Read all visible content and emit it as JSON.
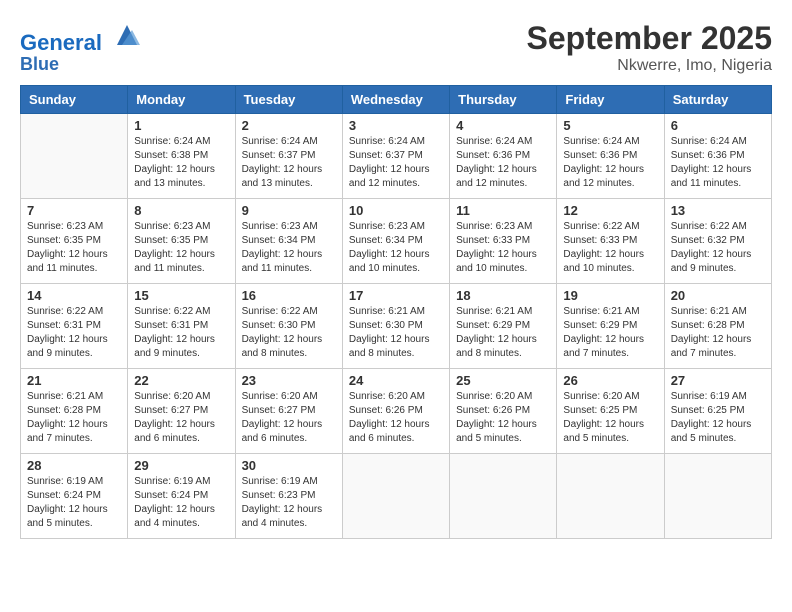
{
  "header": {
    "logo_line1": "General",
    "logo_line2": "Blue",
    "month_title": "September 2025",
    "location": "Nkwerre, Imo, Nigeria"
  },
  "days_of_week": [
    "Sunday",
    "Monday",
    "Tuesday",
    "Wednesday",
    "Thursday",
    "Friday",
    "Saturday"
  ],
  "weeks": [
    [
      {
        "day": "",
        "info": ""
      },
      {
        "day": "1",
        "info": "Sunrise: 6:24 AM\nSunset: 6:38 PM\nDaylight: 12 hours\nand 13 minutes."
      },
      {
        "day": "2",
        "info": "Sunrise: 6:24 AM\nSunset: 6:37 PM\nDaylight: 12 hours\nand 13 minutes."
      },
      {
        "day": "3",
        "info": "Sunrise: 6:24 AM\nSunset: 6:37 PM\nDaylight: 12 hours\nand 12 minutes."
      },
      {
        "day": "4",
        "info": "Sunrise: 6:24 AM\nSunset: 6:36 PM\nDaylight: 12 hours\nand 12 minutes."
      },
      {
        "day": "5",
        "info": "Sunrise: 6:24 AM\nSunset: 6:36 PM\nDaylight: 12 hours\nand 12 minutes."
      },
      {
        "day": "6",
        "info": "Sunrise: 6:24 AM\nSunset: 6:36 PM\nDaylight: 12 hours\nand 11 minutes."
      }
    ],
    [
      {
        "day": "7",
        "info": "Sunrise: 6:23 AM\nSunset: 6:35 PM\nDaylight: 12 hours\nand 11 minutes."
      },
      {
        "day": "8",
        "info": "Sunrise: 6:23 AM\nSunset: 6:35 PM\nDaylight: 12 hours\nand 11 minutes."
      },
      {
        "day": "9",
        "info": "Sunrise: 6:23 AM\nSunset: 6:34 PM\nDaylight: 12 hours\nand 11 minutes."
      },
      {
        "day": "10",
        "info": "Sunrise: 6:23 AM\nSunset: 6:34 PM\nDaylight: 12 hours\nand 10 minutes."
      },
      {
        "day": "11",
        "info": "Sunrise: 6:23 AM\nSunset: 6:33 PM\nDaylight: 12 hours\nand 10 minutes."
      },
      {
        "day": "12",
        "info": "Sunrise: 6:22 AM\nSunset: 6:33 PM\nDaylight: 12 hours\nand 10 minutes."
      },
      {
        "day": "13",
        "info": "Sunrise: 6:22 AM\nSunset: 6:32 PM\nDaylight: 12 hours\nand 9 minutes."
      }
    ],
    [
      {
        "day": "14",
        "info": "Sunrise: 6:22 AM\nSunset: 6:31 PM\nDaylight: 12 hours\nand 9 minutes."
      },
      {
        "day": "15",
        "info": "Sunrise: 6:22 AM\nSunset: 6:31 PM\nDaylight: 12 hours\nand 9 minutes."
      },
      {
        "day": "16",
        "info": "Sunrise: 6:22 AM\nSunset: 6:30 PM\nDaylight: 12 hours\nand 8 minutes."
      },
      {
        "day": "17",
        "info": "Sunrise: 6:21 AM\nSunset: 6:30 PM\nDaylight: 12 hours\nand 8 minutes."
      },
      {
        "day": "18",
        "info": "Sunrise: 6:21 AM\nSunset: 6:29 PM\nDaylight: 12 hours\nand 8 minutes."
      },
      {
        "day": "19",
        "info": "Sunrise: 6:21 AM\nSunset: 6:29 PM\nDaylight: 12 hours\nand 7 minutes."
      },
      {
        "day": "20",
        "info": "Sunrise: 6:21 AM\nSunset: 6:28 PM\nDaylight: 12 hours\nand 7 minutes."
      }
    ],
    [
      {
        "day": "21",
        "info": "Sunrise: 6:21 AM\nSunset: 6:28 PM\nDaylight: 12 hours\nand 7 minutes."
      },
      {
        "day": "22",
        "info": "Sunrise: 6:20 AM\nSunset: 6:27 PM\nDaylight: 12 hours\nand 6 minutes."
      },
      {
        "day": "23",
        "info": "Sunrise: 6:20 AM\nSunset: 6:27 PM\nDaylight: 12 hours\nand 6 minutes."
      },
      {
        "day": "24",
        "info": "Sunrise: 6:20 AM\nSunset: 6:26 PM\nDaylight: 12 hours\nand 6 minutes."
      },
      {
        "day": "25",
        "info": "Sunrise: 6:20 AM\nSunset: 6:26 PM\nDaylight: 12 hours\nand 5 minutes."
      },
      {
        "day": "26",
        "info": "Sunrise: 6:20 AM\nSunset: 6:25 PM\nDaylight: 12 hours\nand 5 minutes."
      },
      {
        "day": "27",
        "info": "Sunrise: 6:19 AM\nSunset: 6:25 PM\nDaylight: 12 hours\nand 5 minutes."
      }
    ],
    [
      {
        "day": "28",
        "info": "Sunrise: 6:19 AM\nSunset: 6:24 PM\nDaylight: 12 hours\nand 5 minutes."
      },
      {
        "day": "29",
        "info": "Sunrise: 6:19 AM\nSunset: 6:24 PM\nDaylight: 12 hours\nand 4 minutes."
      },
      {
        "day": "30",
        "info": "Sunrise: 6:19 AM\nSunset: 6:23 PM\nDaylight: 12 hours\nand 4 minutes."
      },
      {
        "day": "",
        "info": ""
      },
      {
        "day": "",
        "info": ""
      },
      {
        "day": "",
        "info": ""
      },
      {
        "day": "",
        "info": ""
      }
    ]
  ]
}
